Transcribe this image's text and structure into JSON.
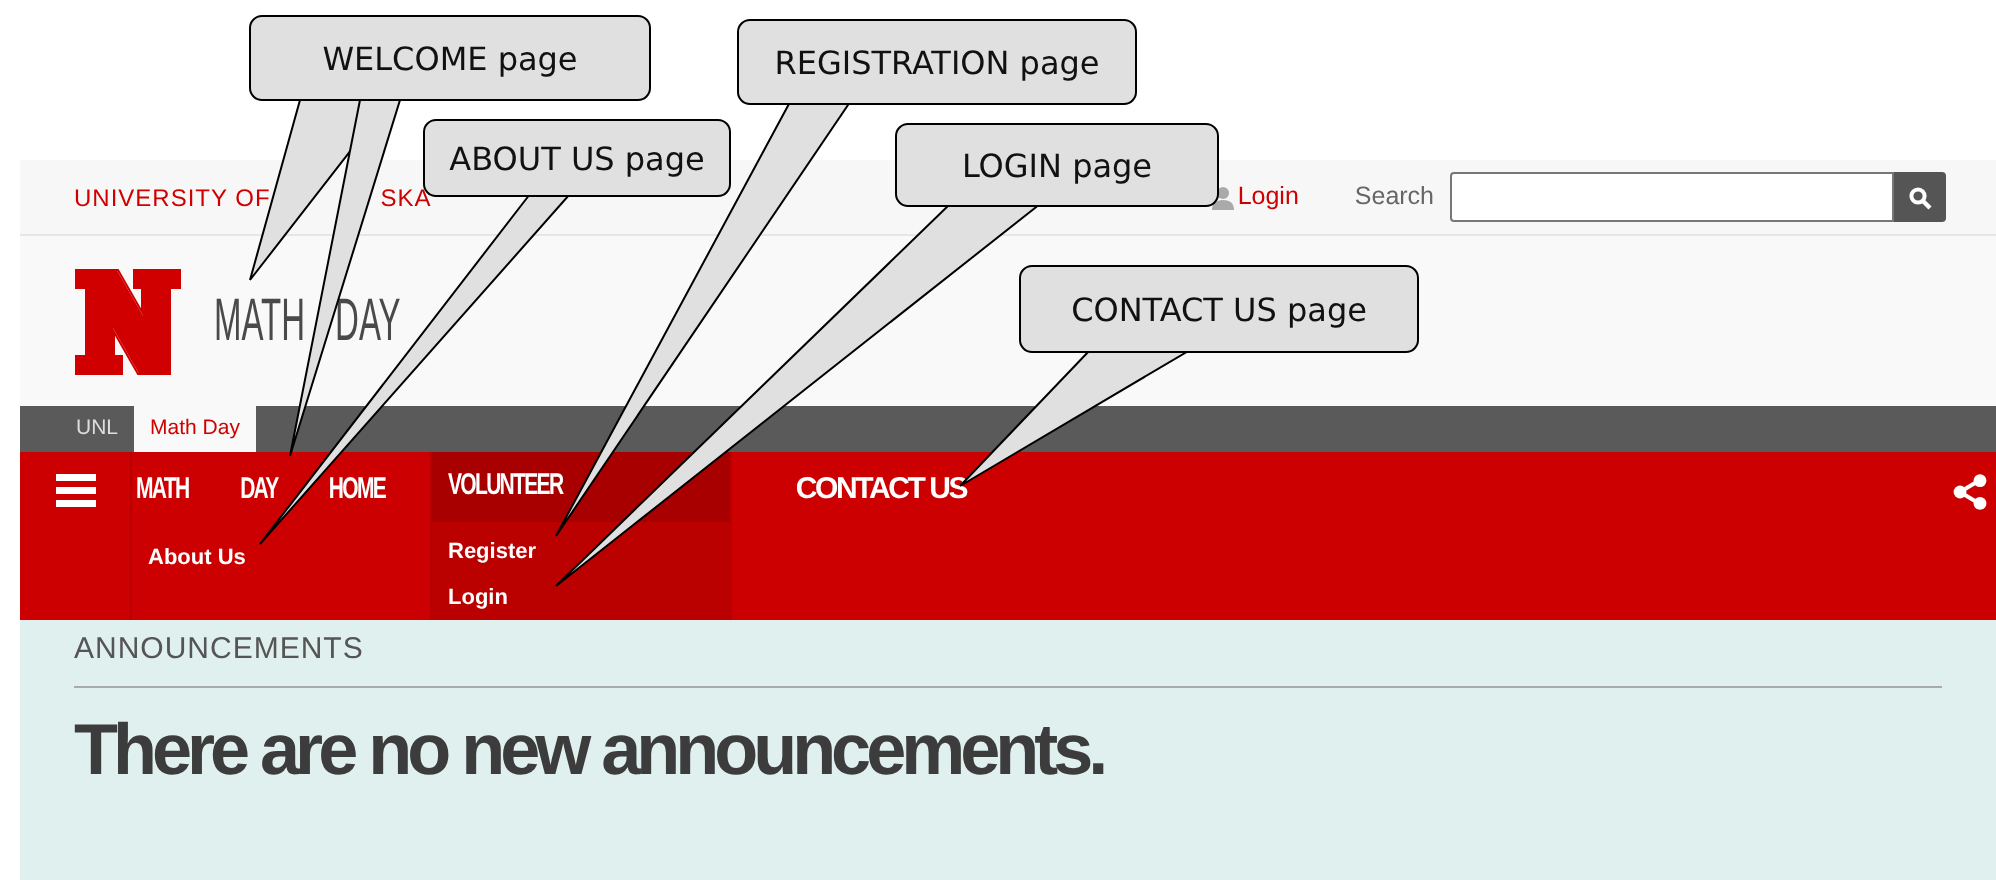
{
  "top_bar": {
    "university_fragments": [
      "UNIVERSITY OF",
      "SKA"
    ],
    "login": "Login",
    "search_label": "Search"
  },
  "site_title": "MATH DAY",
  "breadcrumbs": [
    {
      "label": "UNL",
      "selected": false
    },
    {
      "label": "Math Day",
      "selected": true
    }
  ],
  "nav": {
    "items": [
      {
        "label": "MATH DAY HOME",
        "selected": false,
        "children": [
          {
            "label": "About Us"
          }
        ]
      },
      {
        "label": "VOLUNTEER",
        "selected": true,
        "children": [
          {
            "label": "Register"
          },
          {
            "label": "Login"
          }
        ]
      },
      {
        "label": "CONTACT US",
        "selected": false
      }
    ]
  },
  "announcements": {
    "heading": "ANNOUNCEMENTS",
    "message": "There are no new announcements."
  },
  "callouts": [
    "WELCOME page",
    "ABOUT US page",
    "REGISTRATION page",
    "LOGIN page",
    "CONTACT US page"
  ]
}
